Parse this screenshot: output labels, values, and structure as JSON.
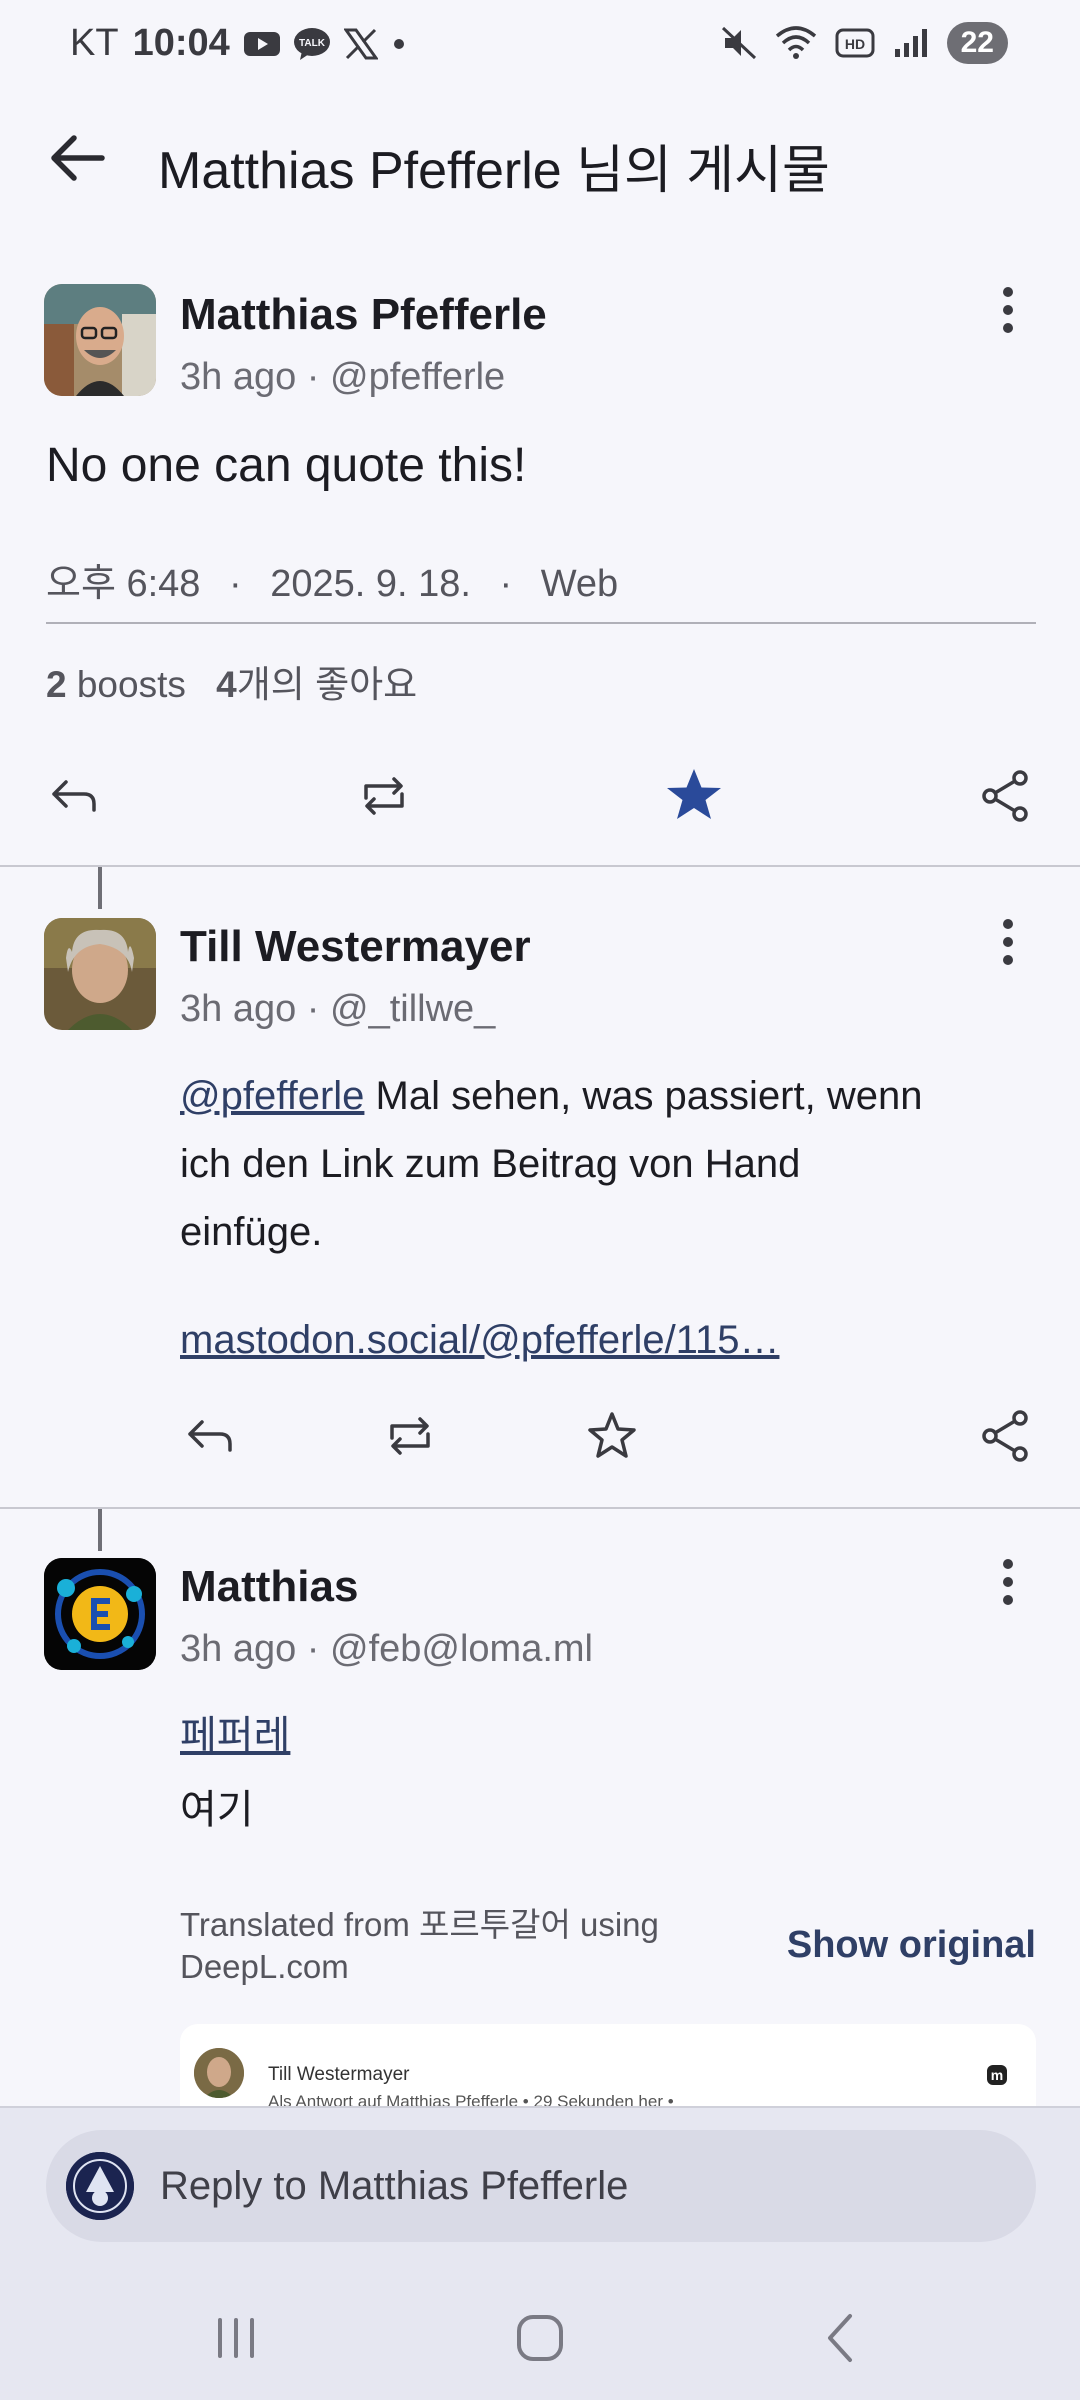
{
  "status_bar": {
    "carrier": "KT",
    "time": "10:04",
    "battery": "22",
    "icons": [
      "youtube-icon",
      "talk-icon",
      "x-icon",
      "dot-icon",
      "mute-icon",
      "wifi-icon",
      "hd-icon",
      "signal-icon"
    ]
  },
  "appbar": {
    "title": "Matthias Pfefferle 님의 게시물"
  },
  "post": {
    "author": "Matthias Pfefferle",
    "meta": "3h ago · @pfefferle",
    "content": "No one can quote this!",
    "time": "오후 6:48",
    "date": "2025. 9. 18.",
    "source": "Web",
    "boosts_count": "2",
    "boosts_label": " boosts",
    "likes_count": "4",
    "likes_label": "개의 좋아요",
    "favourited": true,
    "accent": "#2a4a9a"
  },
  "reply1": {
    "author": "Till Westermayer",
    "meta": "3h ago · @_tillwe_",
    "mention": "@pfefferle",
    "line1_rest": " Mal sehen, was passiert, wenn",
    "line2": "ich den Link zum Beitrag von Hand",
    "line3": "einfüge.",
    "link": "mastodon.social/@pfefferle/115…"
  },
  "reply2": {
    "author": "Matthias",
    "meta": "3h ago · @feb@loma.ml",
    "mention": "페퍼레",
    "text": "여기",
    "translated_line1": "Translated from 포르투갈어 using",
    "translated_line2": "DeepL.com",
    "show_original": "Show original",
    "embed_author": "Till Westermayer",
    "embed_meta": "Als Antwort auf Matthias Pfefferle • 29 Sekunden her •"
  },
  "composer": {
    "placeholder": "Reply to Matthias Pfefferle"
  }
}
